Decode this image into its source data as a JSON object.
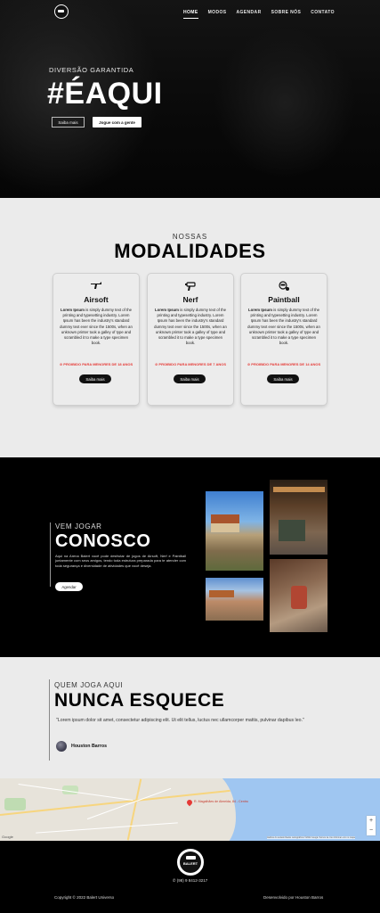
{
  "nav": {
    "items": [
      "HOME",
      "MODOS",
      "AGENDAR",
      "SOBRE NÓS",
      "CONTATO"
    ],
    "active": "HOME"
  },
  "hero": {
    "kicker": "DIVERSÃO GARANTIDA",
    "title": "#ÉAQUI",
    "btn_outline": "Saiba mais",
    "btn_primary": "Jogue com a gente"
  },
  "modalidades": {
    "kicker": "NOSSAS",
    "title": "MODALIDADES",
    "cards": [
      {
        "name": "Airsoft",
        "icon": "airsoft-gun-icon",
        "lead": "Lorem Ipsum",
        "text": " is simply dummy text of the printing and typesetting industry. Lorem Ipsum has been the industry's standard dummy text ever since the 1500s, when an unknown printer took a galley of type and scrambled it to make a type specimen book.",
        "warning": "PROIBIDO PARA MENORES DE 18 ANOS",
        "button": "Saiba mais"
      },
      {
        "name": "Nerf",
        "icon": "nerf-blaster-icon",
        "lead": "Lorem Ipsum",
        "text": " is simply dummy text of the printing and typesetting industry. Lorem Ipsum has been the industry's standard dummy text ever since the 1500s, when an unknown printer took a galley of type and scrambled it to make a type specimen book.",
        "warning": "PROIBIDO PARA MENORES DE 7 ANOS",
        "button": "Saiba mais"
      },
      {
        "name": "Paintball",
        "icon": "paintball-mask-icon",
        "lead": "Lorem Ipsum",
        "text": " is simply dummy text of the printing and typesetting industry. Lorem Ipsum has been the industry's standard dummy text ever since the 1500s, when an unknown printer took a galley of type and scrambled it to make a type specimen book.",
        "warning": "PROIBIDO PARA MENORES DE 14 ANOS",
        "button": "Saiba mais"
      }
    ]
  },
  "conosco": {
    "kicker": "VEM JOGAR",
    "title": "CONOSCO",
    "text": "Aqui na Arena Balert você pode desfrutar de jogos de Airsoft, Nerf e Paintball juntamente com seus amigos, tendo toda estrutura preparada para te atender com toda segurança e diversidade de atividades que você deseja.",
    "button": "Agendar"
  },
  "testimonial": {
    "kicker": "QUEM JOGA AQUI",
    "title": "NUNCA ESQUECE",
    "quote": "\"Lorem ipsum dolor sit amet, consectetur adipiscing elit. Ut elit tellus, luctus nec ullamcorper mattis, pulvinar dapibus leo.\"",
    "author": "Houston Barros"
  },
  "map": {
    "pin_label": "R. Magalhães de Almeida, 84 - Centro",
    "attribution": "Atalhos do teclado  Dados cartográficos ©2022 Google  Termos de Uso  Informar erro no mapa",
    "google": "Google",
    "zoom_in": "+",
    "zoom_out": "−"
  },
  "footer": {
    "logo_text": "BALERT",
    "phone": "(98) 9 8412-3217",
    "copyright": "Copyright © 2022 Balert Universo",
    "developer": "Desenvolvido por Houston Barros"
  }
}
